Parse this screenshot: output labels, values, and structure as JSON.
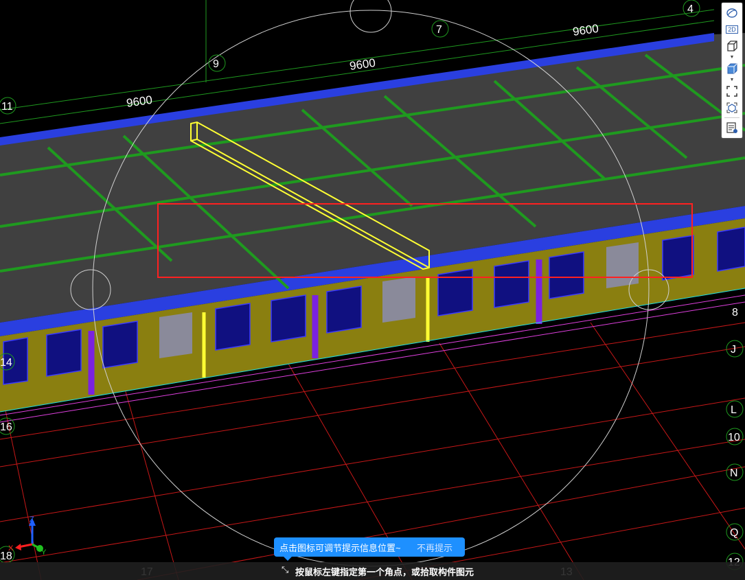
{
  "viewport": {
    "grid_axes": {
      "top_numbers": [
        "4",
        "7",
        "9",
        "11"
      ],
      "left_numbers": [
        "14",
        "16",
        "18"
      ],
      "bottom_numbers": [
        "17",
        "13"
      ],
      "right_letters": [
        "J",
        "L",
        "10",
        "N",
        "Q",
        "12",
        "8"
      ],
      "dimensions": [
        "9600",
        "9600",
        "9600"
      ]
    },
    "axis_triad": {
      "x": "X",
      "y": "Y",
      "z": "Z"
    },
    "colors": {
      "slab": "#454545",
      "slab_edge": "#2a3fe0",
      "beam_grid": "#1f9a1f",
      "wall": "#8a7f10",
      "window": "#101080",
      "gridline": "#d01010",
      "selection_box": "#ff2020",
      "highlight_beam": "#ffff33",
      "column": "#7a22e0"
    }
  },
  "toolbar": {
    "buttons": [
      {
        "name": "orbit",
        "label": ""
      },
      {
        "name": "2d",
        "label": "2D"
      },
      {
        "name": "box-view",
        "label": ""
      },
      {
        "name": "solid-view",
        "label": ""
      },
      {
        "name": "fit-view",
        "label": ""
      },
      {
        "name": "iso-view",
        "label": ""
      },
      {
        "name": "display-settings",
        "label": ""
      }
    ]
  },
  "tip": {
    "message": "点击图标可调节提示信息位置~",
    "dismiss": "不再提示"
  },
  "status": {
    "prompt": "按鼠标左键指定第一个角点，或拾取构件图元"
  }
}
